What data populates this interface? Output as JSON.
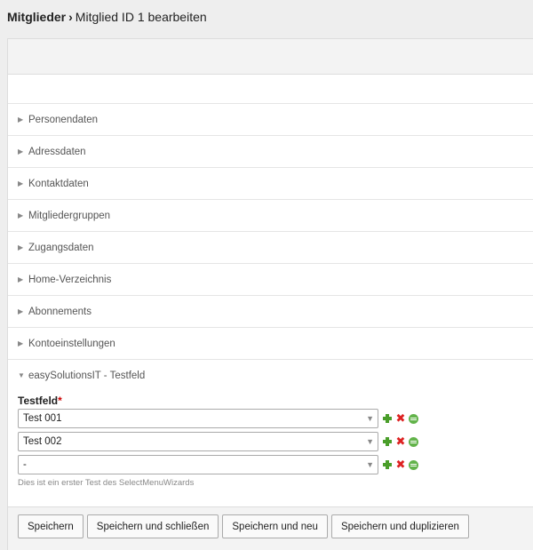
{
  "breadcrumb": {
    "section": "Mitglieder",
    "separator": "›",
    "current": "Mitglied ID 1 bearbeiten"
  },
  "legends": [
    {
      "label": "Personendaten",
      "icon": "triangle-right-icon"
    },
    {
      "label": "Adressdaten",
      "icon": "triangle-right-icon"
    },
    {
      "label": "Kontaktdaten",
      "icon": "triangle-right-icon"
    },
    {
      "label": "Mitgliedergruppen",
      "icon": "triangle-right-icon"
    },
    {
      "label": "Zugangsdaten",
      "icon": "triangle-right-icon"
    },
    {
      "label": "Home-Verzeichnis",
      "icon": "triangle-right-icon"
    },
    {
      "label": "Abonnements",
      "icon": "triangle-right-icon"
    },
    {
      "label": "Kontoeinstellungen",
      "icon": "triangle-right-icon"
    },
    {
      "label": "easySolutionsIT - Testfeld",
      "icon": "triangle-down-icon"
    }
  ],
  "field": {
    "label": "Testfeld",
    "required_mark": "*",
    "rows": [
      {
        "value": "Test 001"
      },
      {
        "value": "Test 002"
      },
      {
        "value": "-"
      }
    ],
    "help": "Dies ist ein erster Test des SelectMenuWizards"
  },
  "buttons": {
    "save": "Speichern",
    "save_close": "Speichern und schließen",
    "save_new": "Speichern und neu",
    "save_duplicate": "Speichern und duplizieren"
  },
  "colors": {
    "required": "#cc0000",
    "add_icon": "#4a9e2a",
    "delete_icon": "#dd2222",
    "move_icon": "#62b34a"
  }
}
